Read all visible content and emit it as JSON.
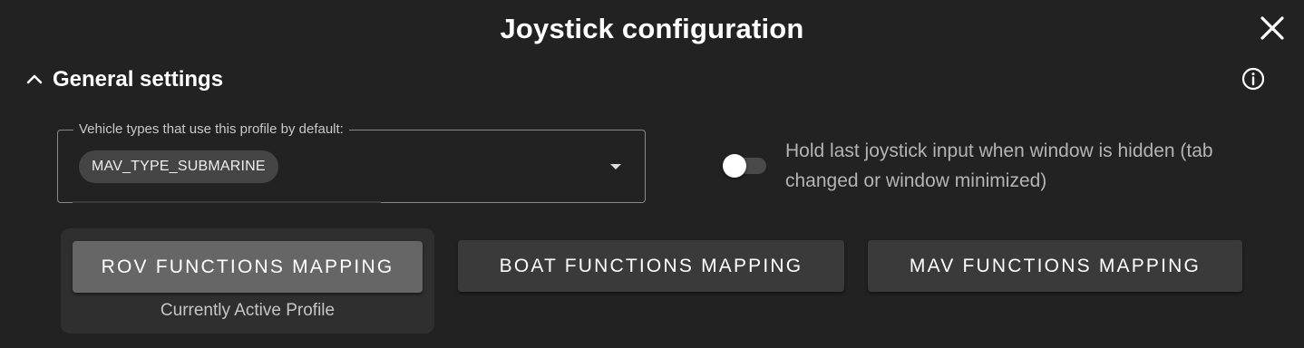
{
  "dialog": {
    "title": "Joystick configuration"
  },
  "general_settings": {
    "title": "General settings",
    "expanded": true,
    "vehicle_types_field": {
      "label": "Vehicle types that use this profile by default:",
      "selected_chips": [
        "MAV_TYPE_SUBMARINE"
      ]
    },
    "hold_last_input_toggle": {
      "label": "Hold last joystick input when window is hidden (tab changed or window minimized)",
      "checked": false
    }
  },
  "mapping_buttons": [
    {
      "label": "ROV FUNCTIONS MAPPING",
      "active": true
    },
    {
      "label": "BOAT FUNCTIONS MAPPING",
      "active": false
    },
    {
      "label": "MAV FUNCTIONS MAPPING",
      "active": false
    }
  ],
  "active_profile_caption": "Currently Active Profile",
  "icons": {
    "close": "close-icon",
    "collapse": "chevron-up-icon",
    "info": "info-icon",
    "dropdown": "caret-down-icon"
  },
  "colors": {
    "background": "#222222",
    "active_button": "#666666",
    "inactive_button": "#3a3a3a",
    "active_card": "#2f2f2f"
  }
}
